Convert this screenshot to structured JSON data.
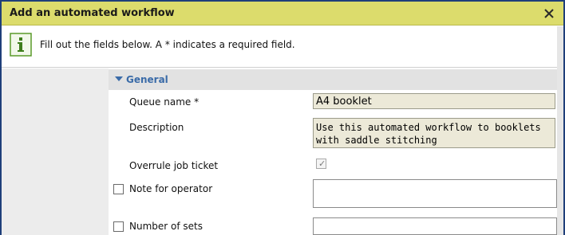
{
  "dialog": {
    "title": "Add an automated workflow",
    "info_text": "Fill out the fields below. A * indicates a required field."
  },
  "icons": {
    "info": "info-icon",
    "close": "close-icon",
    "collapse": "chevron-down-icon"
  },
  "section": {
    "label": "General"
  },
  "fields": {
    "queue_name": {
      "label": "Queue name *",
      "value": "A4 booklet"
    },
    "description": {
      "label": "Description",
      "value": "Use this automated workflow to booklets\nwith saddle stitching"
    },
    "overrule": {
      "label": "Overrule job ticket",
      "checked": true
    },
    "note_for_operator": {
      "label": "Note for operator",
      "enabled": false,
      "value": ""
    },
    "number_of_sets": {
      "label": "Number of sets",
      "enabled": false,
      "value": ""
    }
  },
  "colors": {
    "titlebar": "#dcdc6c",
    "accent": "#3a6ba8",
    "field_bg": "#ece9d8",
    "frame": "#1f3f7a"
  }
}
